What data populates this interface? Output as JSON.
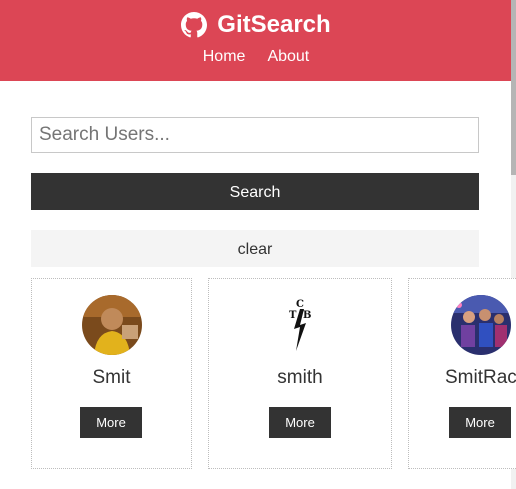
{
  "navbar": {
    "icon": "github-icon",
    "title": "GitSearch",
    "links": [
      {
        "label": "Home"
      },
      {
        "label": "About"
      }
    ],
    "background": "#dc4655"
  },
  "search": {
    "placeholder": "Search Users...",
    "value": "",
    "button_label": "Search",
    "clear_label": "clear"
  },
  "users": [
    {
      "login": "Smit",
      "more_label": "More"
    },
    {
      "login": "smith",
      "more_label": "More"
    },
    {
      "login": "SmitRac",
      "more_label": "More"
    }
  ],
  "colors": {
    "accent": "#dc4655",
    "dark_button": "#333333",
    "light_button": "#f4f4f4"
  }
}
